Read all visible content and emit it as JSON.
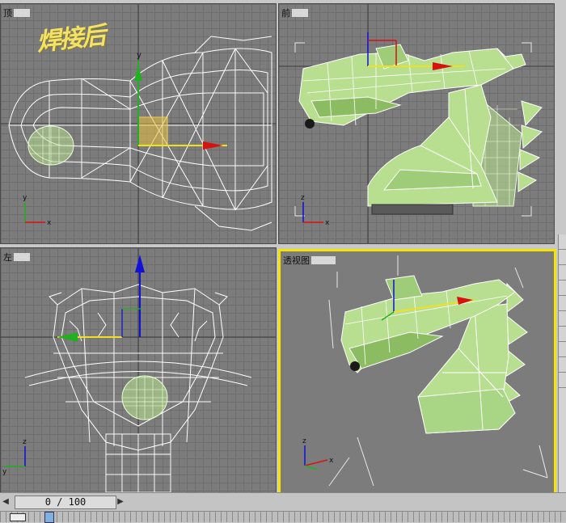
{
  "viewports": {
    "top": {
      "label": "顶"
    },
    "front": {
      "label": "前"
    },
    "left": {
      "label": "左"
    },
    "perspective": {
      "label": "透视图"
    }
  },
  "overlay_text": "焊接后",
  "axes": {
    "x": "x",
    "y": "y",
    "z": "z"
  },
  "time_slider": {
    "value": "0 / 100",
    "current": 0,
    "total": 100
  },
  "colors": {
    "active_border": "#f5e400",
    "model_fill": "#b8df90",
    "wire": "#ffffff",
    "gizmo_x": "#d81010",
    "gizmo_y": "#20b020",
    "gizmo_z": "#1010d8"
  }
}
